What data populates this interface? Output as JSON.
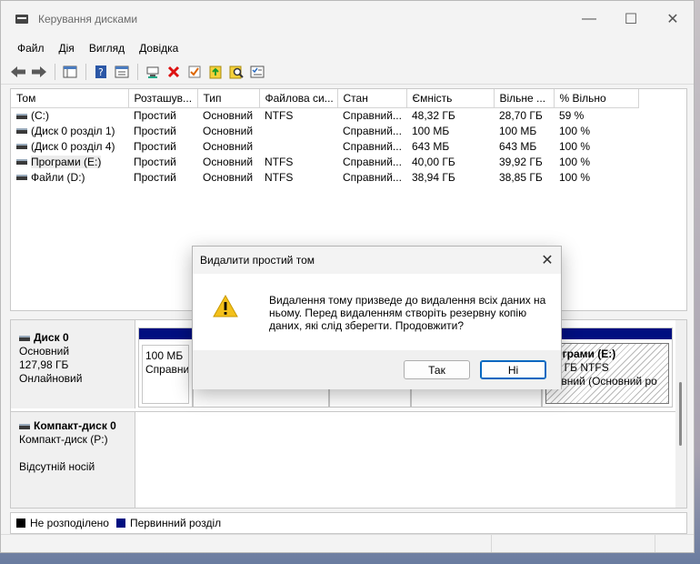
{
  "window": {
    "title": "Керування дисками",
    "controls": {
      "minimize": "—",
      "maximize": "☐",
      "close": "✕"
    }
  },
  "menu": [
    "Файл",
    "Дія",
    "Вигляд",
    "Довідка"
  ],
  "toolbar_icons": [
    "back-icon",
    "forward-icon",
    "console-tree-icon",
    "help-icon",
    "properties-icon",
    "connect-icon",
    "delete-icon",
    "check-icon",
    "new-folder-icon",
    "search-icon",
    "list-icon"
  ],
  "volume_table": {
    "columns": [
      "Том",
      "Розташув...",
      "Тип",
      "Файлова си...",
      "Стан",
      "Ємність",
      "Вільне ...",
      "% Вільно"
    ],
    "rows": [
      [
        "(C:)",
        "Простий",
        "Основний",
        "NTFS",
        "Справний...",
        "48,32 ГБ",
        "28,70 ГБ",
        "59 %"
      ],
      [
        "(Диск 0 розділ 1)",
        "Простий",
        "Основний",
        "",
        "Справний...",
        "100 МБ",
        "100 МБ",
        "100 %"
      ],
      [
        "(Диск 0 розділ 4)",
        "Простий",
        "Основний",
        "",
        "Справний...",
        "643 МБ",
        "643 МБ",
        "100 %"
      ],
      [
        "Програми (E:)",
        "Простий",
        "Основний",
        "NTFS",
        "Справний...",
        "40,00 ГБ",
        "39,92 ГБ",
        "100 %"
      ],
      [
        "Файли (D:)",
        "Простий",
        "Основний",
        "NTFS",
        "Справний...",
        "38,94 ГБ",
        "38,85 ГБ",
        "100 %"
      ]
    ]
  },
  "disks": [
    {
      "name": "Диск 0",
      "type": "Основний",
      "size": "127,98 ГБ",
      "state": "Онлайновий"
    },
    {
      "name": "Компакт-диск 0",
      "type": "Компакт-диск (P:)",
      "size": "",
      "state": "Відсутній носій"
    }
  ],
  "partitions": {
    "first": {
      "size": "100 МБ",
      "state": "Справни"
    },
    "programs": {
      "name": "рограми  (E:)",
      "size": "00 ГБ NTFS",
      "state": "равний (Основний ро"
    }
  },
  "legend": [
    {
      "label": "Не розподілено",
      "color": "#000000"
    },
    {
      "label": "Первинний розділ",
      "color": "#000f80"
    }
  ],
  "dialog": {
    "title": "Видалити простий том",
    "message": "Видалення тому призведе до видалення всіх даних на ньому. Перед видаленням створіть резервну копію даних, які слід зберегти. Продовжити?",
    "yes": "Так",
    "no": "Ні"
  }
}
